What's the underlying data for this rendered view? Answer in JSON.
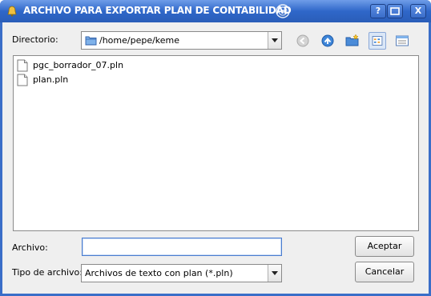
{
  "window": {
    "title": "ARCHIVO PARA EXPORTAR PLAN DE CONTABILIDAD",
    "help_label": "?",
    "close_label": "X"
  },
  "directory": {
    "label": "Directorio:",
    "path": "/home/pepe/keme"
  },
  "toolbar": {
    "icons": [
      "back-icon",
      "up-icon",
      "new-folder-icon",
      "list-view-icon",
      "detail-view-icon"
    ]
  },
  "files": [
    {
      "name": "pgc_borrador_07.pln"
    },
    {
      "name": "plan.pln"
    }
  ],
  "filename": {
    "label": "Archivo:",
    "value": ""
  },
  "filetype": {
    "label": "Tipo de archivo:",
    "selected": "Archivos de texto con plan (*.pln)"
  },
  "buttons": {
    "accept": "Aceptar",
    "cancel": "Cancelar"
  },
  "colors": {
    "titlebar": "#2f67c9",
    "accent": "#4a7ccf",
    "background": "#efefef"
  }
}
